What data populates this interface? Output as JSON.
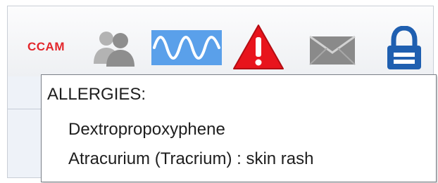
{
  "toolbar": {
    "ccam_label": "CCAM",
    "icons": [
      "users-icon",
      "waveform-icon",
      "alert-icon",
      "mail-icon",
      "lock-icon"
    ],
    "colors": {
      "ccam": "#e3262b",
      "waveform_bg": "#5aa0ea",
      "alert": "#e8141c",
      "lock": "#1f5fb0",
      "users": "#9a9a9a",
      "mail": "#8a8a8a"
    }
  },
  "tooltip": {
    "title": "ALLERGIES:",
    "items": [
      "Dextropropoxyphene",
      "Atracurium (Tracrium) : skin rash"
    ]
  }
}
